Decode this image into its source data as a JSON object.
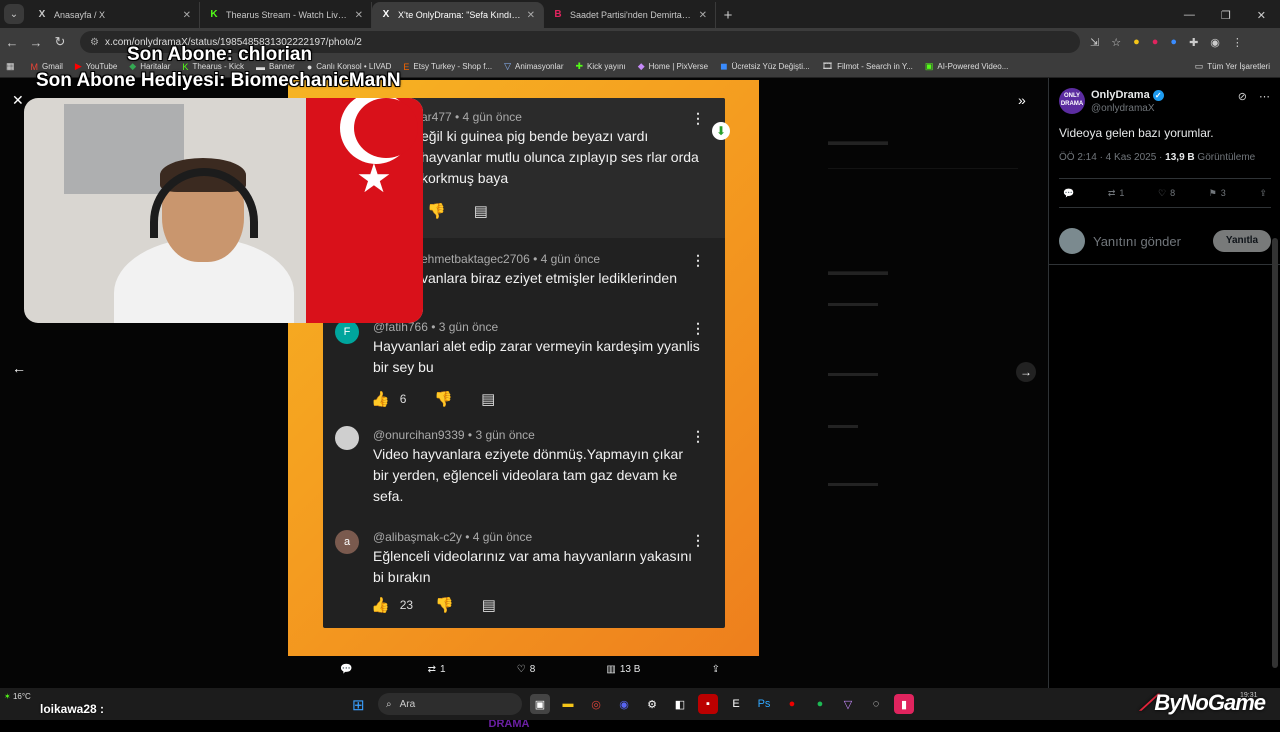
{
  "browser": {
    "tabs": [
      {
        "favicon": "X",
        "title": "Anasayfa / X"
      },
      {
        "favicon": "K",
        "title": "Thearus Stream - Watch Live on Kick"
      },
      {
        "favicon": "X",
        "title": "X'te OnlyDrama: \"Sefa Kındır'ın"
      },
      {
        "favicon": "B",
        "title": "Saadet Partisi'nden Demirtaş ve"
      }
    ],
    "url": "x.com/onlydramaX/status/1985485831302222197/photo/2",
    "bookmarks": [
      "Gmail",
      "YouTube",
      "Haritalar",
      "Thearus - Kick",
      "Banner",
      "Canlı Konsol • LIVAD",
      "Etsy Turkey - Shop f...",
      "Animasyonlar",
      "Kick yayını",
      "Home | PixVerse",
      "Ücretsiz Yüz Değişti...",
      "Filmot - Search in Y...",
      "AI-Powered Video..."
    ],
    "bookmarks_all": "Tüm Yer İşaretleri"
  },
  "overlay": {
    "line1": "Son Abone: chlorian",
    "line2": "Son Abone Hediyesi: BiomechanicManN"
  },
  "comments": [
    {
      "handle": "ar477 • 4 gün önce",
      "text": "eğil ki guinea pig bende beyazı vardı hayvanlar mutlu olunca zıplayıp ses rlar orda korkmuş baya"
    },
    {
      "handle": "ehmetbaktagec2706 • 4 gün önce",
      "text": "vanlara biraz eziyet etmişler lediklerinden"
    },
    {
      "avatar": "F",
      "handle": "@fatih766 • 3 gün önce",
      "text": "Hayvanlari alet edip zarar vermeyin kardeşim yyanlis bir sey bu",
      "likes": "6"
    },
    {
      "avatar": "",
      "handle": "@onurcihan9339 • 3 gün önce",
      "text": "Video hayvanlara eziyete dönmüş.Yapmayın çıkar bir yerden, eğlenceli videolara tam gaz devam ke sefa."
    },
    {
      "avatar": "a",
      "handle": "@alibaşmak-c2y • 4 gün önce",
      "text": "Eğlenceli videolarınız var ama hayvanların yakasını bi bırakın",
      "likes": "23"
    }
  ],
  "photo_logo": "ONLY DRAMA",
  "viewer_actions": {
    "replies": "",
    "retweets": "1",
    "likes": "8",
    "views": "13 B"
  },
  "tweet": {
    "author": "OnlyDrama",
    "handle": "@onlydramaX",
    "avatar_text": "ONLY DRAMA",
    "text": "Videoya gelen bazı yorumlar.",
    "time": "ÖÖ 2:14 · 4 Kas 2025 · ",
    "views": "13,9 B",
    "views_label": " Görüntüleme",
    "retweets": "1",
    "likes": "8",
    "bookmarks": "3",
    "reply_placeholder": "Yanıtını gönder",
    "reply_button": "Yanıtla"
  },
  "taskbar": {
    "weather": "16°C",
    "user": "loikawa28 :",
    "search": "Ara",
    "clock": "19:31"
  },
  "watermark": "ByNoGame",
  "colors": {
    "accent": "#1d9bf0",
    "photo_bg": "#f5a020",
    "card_bg": "#212121"
  }
}
